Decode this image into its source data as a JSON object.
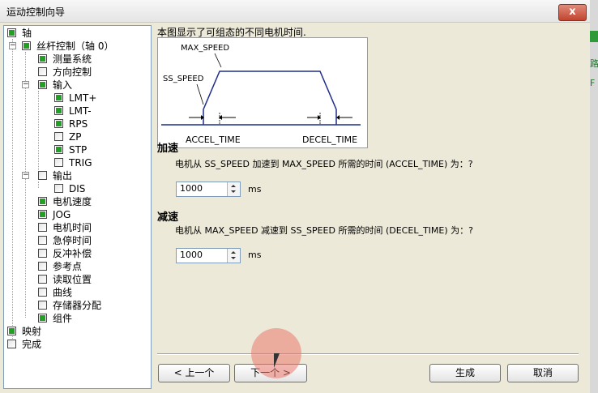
{
  "window": {
    "title": "运动控制向导",
    "close_glyph": "x"
  },
  "background_app": {
    "text1": "路",
    "text2": "F"
  },
  "tree": {
    "items": [
      {
        "label": "轴",
        "checked": true
      },
      {
        "label": "丝杆控制（轴 0）",
        "checked": true
      },
      {
        "label": "测量系统",
        "checked": true
      },
      {
        "label": "方向控制",
        "checked": false
      },
      {
        "label": "输入",
        "checked": true
      },
      {
        "label": "LMT+",
        "checked": true
      },
      {
        "label": "LMT-",
        "checked": true
      },
      {
        "label": "RPS",
        "checked": true
      },
      {
        "label": "ZP",
        "checked": false
      },
      {
        "label": "STP",
        "checked": true
      },
      {
        "label": "TRIG",
        "checked": false
      },
      {
        "label": "输出",
        "checked": false
      },
      {
        "label": "DIS",
        "checked": false
      },
      {
        "label": "电机速度",
        "checked": true
      },
      {
        "label": "JOG",
        "checked": true
      },
      {
        "label": "电机时间",
        "checked": false
      },
      {
        "label": "急停时间",
        "checked": false
      },
      {
        "label": "反冲补偿",
        "checked": false
      },
      {
        "label": "参考点",
        "checked": false
      },
      {
        "label": "读取位置",
        "checked": false
      },
      {
        "label": "曲线",
        "checked": false
      },
      {
        "label": "存储器分配",
        "checked": false
      },
      {
        "label": "组件",
        "checked": true
      },
      {
        "label": "映射",
        "checked": true
      },
      {
        "label": "完成",
        "checked": false
      }
    ]
  },
  "content": {
    "description": "本图显示了可组态的不同电机时间.",
    "diagram": {
      "max_speed": "MAX_SPEED",
      "ss_speed": "SS_SPEED",
      "accel_time": "ACCEL_TIME",
      "decel_time": "DECEL_TIME"
    },
    "accel": {
      "title": "加速",
      "question": "电机从 SS_SPEED 加速到 MAX_SPEED 所需的时间 (ACCEL_TIME) 为：?",
      "value": "1000",
      "unit": "ms"
    },
    "decel": {
      "title": "减速",
      "question": "电机从 MAX_SPEED 减速到 SS_SPEED 所需的时间 (DECEL_TIME) 为：?",
      "value": "1000",
      "unit": "ms"
    }
  },
  "buttons": {
    "prev": "< 上一个",
    "next": "下一个 >",
    "generate": "生成",
    "cancel": "取消"
  },
  "colors": {
    "check_on": "#21a121",
    "diagram_line": "#1f2d8a",
    "close_button": "#c1442f"
  }
}
